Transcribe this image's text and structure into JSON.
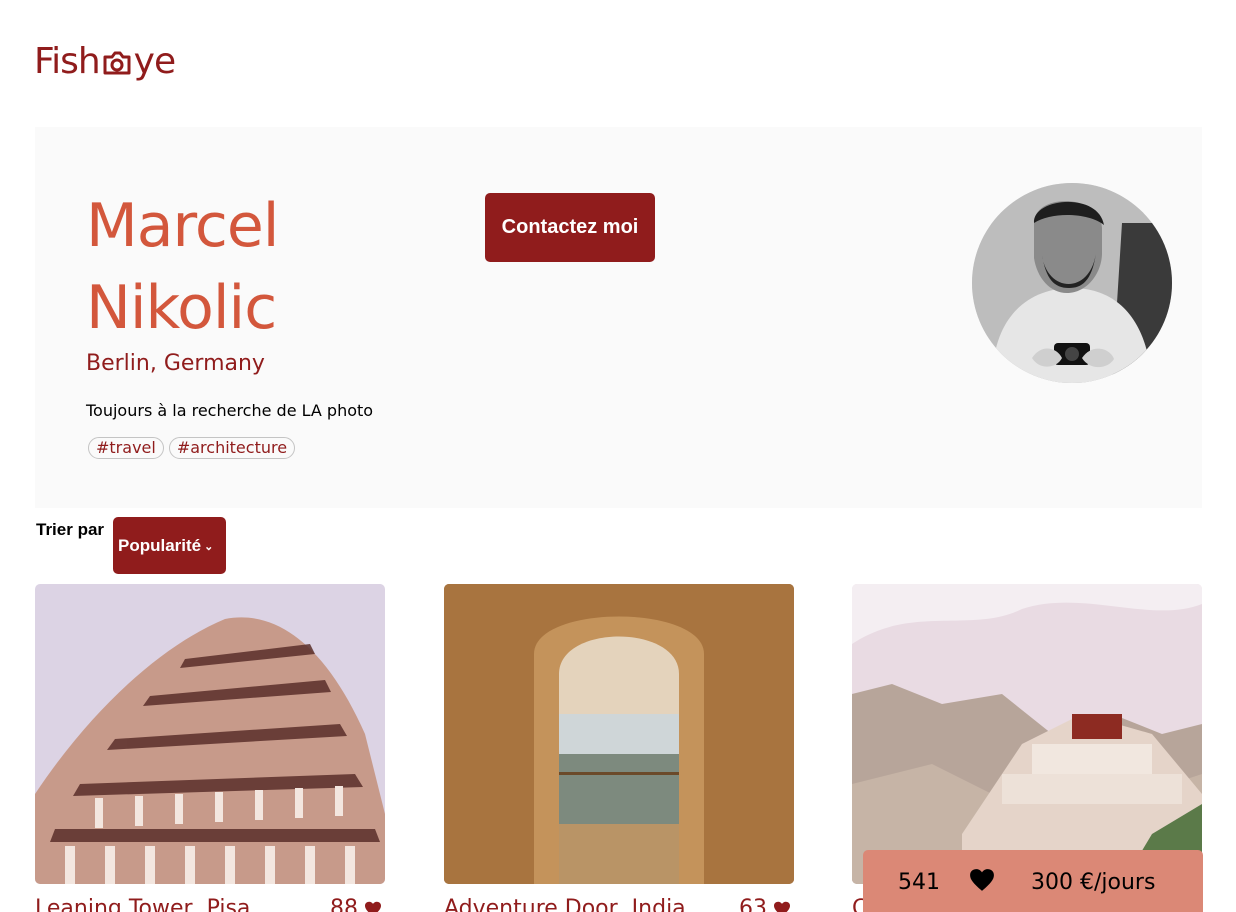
{
  "brand": {
    "name_left": "Fish",
    "name_right": "ye",
    "accent": "#901C1C"
  },
  "photographer": {
    "name_line1": "Marcel",
    "name_line2": "Nikolic",
    "location": "Berlin, Germany",
    "tagline": "Toujours à la recherche de LA photo",
    "tags": [
      "#travel",
      "#architecture"
    ],
    "contact_label": "Contactez moi"
  },
  "sort": {
    "label": "Trier par",
    "selected": "Popularité"
  },
  "media": [
    {
      "title": "Leaning Tower, Pisa",
      "likes": "88"
    },
    {
      "title": "Adventure Door, India",
      "likes": "63"
    },
    {
      "title": "C",
      "likes": ""
    }
  ],
  "stats": {
    "total_likes": "541",
    "price": "300 €/jours"
  },
  "colors": {
    "primary": "#901C1C",
    "secondary": "#D3573C",
    "stats_bg": "#DB8876",
    "header_bg": "#FAFAFA"
  }
}
